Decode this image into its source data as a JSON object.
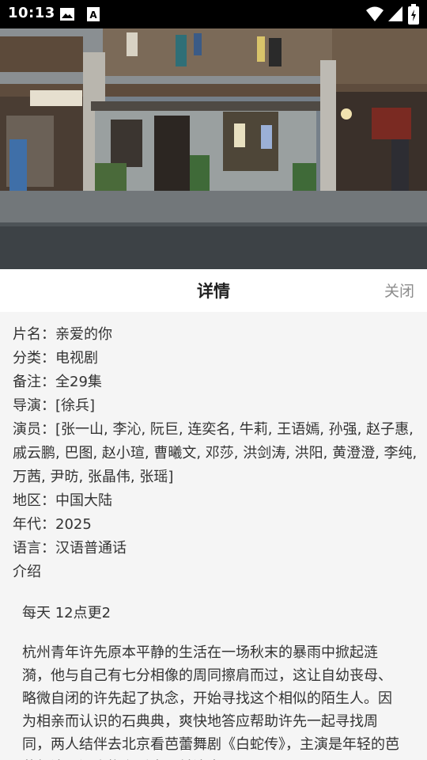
{
  "status_bar": {
    "time": "10:13"
  },
  "sheet": {
    "title": "详情",
    "close_label": "关闭"
  },
  "details": {
    "title": "片名：亲爱的你",
    "category": "分类：电视剧",
    "note": "备注：全29集",
    "director": "导演：[徐兵]",
    "actors": "演员：[张一山, 李沁, 阮巨, 连奕名, 牛莉, 王语嫣, 孙强, 赵子惠, 戚云鹏, 巴图, 赵小瑄, 曹曦文, 邓莎, 洪剑涛, 洪阳, 黄澄澄, 李纯, 万茜, 尹昉, 张晶伟, 张瑶]",
    "region": "地区：中国大陆",
    "year": "年代：2025",
    "language": "语言：汉语普通话",
    "intro_label": "介绍",
    "update_tag": "每天 12点更2",
    "intro_text": "杭州青年许先原本平静的生活在一场秋末的暴雨中掀起涟漪，他与自己有七分相像的周同擦肩而过，这让自幼丧母、略微自闭的许先起了执念，开始寻找这个相似的陌生人。因为相亲而认识的石典典，爽快地答应帮助许先一起寻找周同，两人结伴去北京看芭蕾舞剧《白蛇传》，主演是年轻的芭蕾舞演员汪小梅和乔光，前演出"
  }
}
